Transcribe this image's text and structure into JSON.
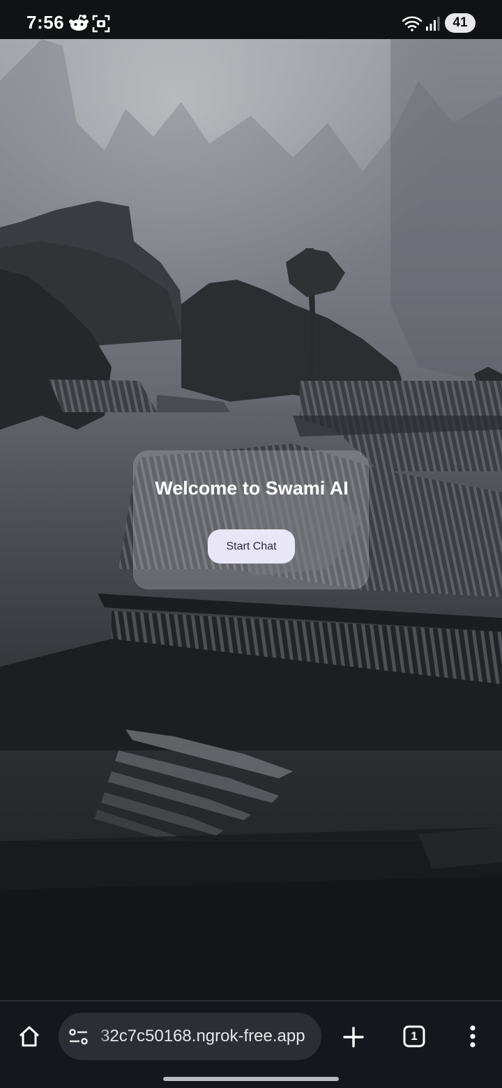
{
  "status_bar": {
    "time": "7:56",
    "battery": "41",
    "icons": [
      "reddit-icon",
      "screenshot-icon",
      "wifi-icon",
      "signal-icon"
    ]
  },
  "welcome": {
    "title": "Welcome to Swami AI",
    "start_button": "Start Chat"
  },
  "browser": {
    "url": "32c7c50168.ngrok-free.app",
    "tab_count": "1",
    "icons": [
      "home-icon",
      "site-settings-icon",
      "new-tab-icon",
      "tabs-icon",
      "more-menu-icon"
    ]
  },
  "colors": {
    "card_bg": "rgba(200,202,210,0.28)",
    "button_bg": "#e9e6f6",
    "bar_bg": "#15171c"
  }
}
